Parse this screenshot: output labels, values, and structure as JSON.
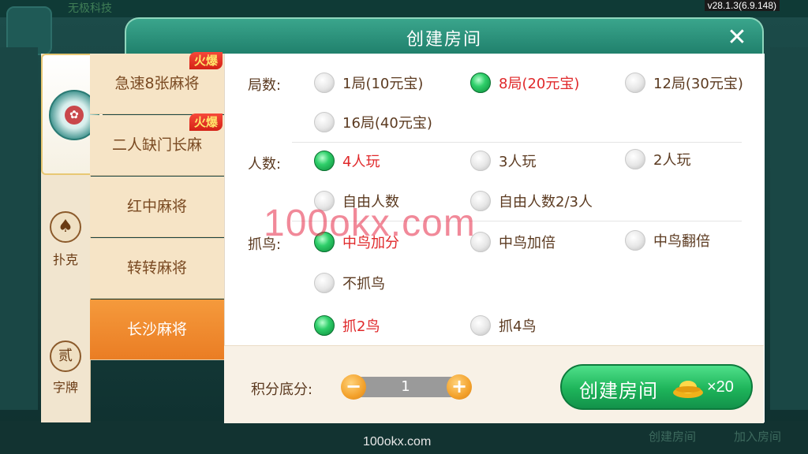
{
  "app": {
    "version": "v28.1.3(6.9.148)",
    "background_labels": [
      "无极科技"
    ],
    "bottom_watermark": "100okx.com",
    "overlay_watermark": "100okx.com",
    "bottom_bar": [
      "创建房间",
      "加入房间"
    ]
  },
  "dialog": {
    "title": "创建房间",
    "close_icon": "close-icon"
  },
  "categories": [
    {
      "label": "",
      "icon": "mahjong-emblem-icon",
      "active": true
    },
    {
      "label": "扑克",
      "icon": "spade-icon",
      "active": false
    },
    {
      "label": "字牌",
      "icon": "zipai-icon",
      "active": false
    }
  ],
  "games": [
    {
      "label": "急速8张麻将",
      "badge": "火爆",
      "active": false
    },
    {
      "label": "二人缺门长麻",
      "badge": "火爆",
      "active": false
    },
    {
      "label": "红中麻将",
      "badge": "",
      "active": false
    },
    {
      "label": "转转麻将",
      "badge": "",
      "active": false
    },
    {
      "label": "长沙麻将",
      "badge": "",
      "active": true
    }
  ],
  "options": {
    "rounds": {
      "label": "局数:",
      "items": [
        {
          "text": "1局(10元宝)",
          "selected": false
        },
        {
          "text": "8局(20元宝)",
          "selected": true
        },
        {
          "text": "12局(30元宝)",
          "selected": false
        },
        {
          "text": "16局(40元宝)",
          "selected": false
        }
      ]
    },
    "players": {
      "label": "人数:",
      "items": [
        {
          "text": "4人玩",
          "selected": true
        },
        {
          "text": "3人玩",
          "selected": false
        },
        {
          "text": "2人玩",
          "selected": false
        },
        {
          "text": "自由人数",
          "selected": false
        },
        {
          "text": "自由人数2/3人",
          "selected": false
        }
      ]
    },
    "birds": {
      "label": "抓鸟:",
      "items": [
        {
          "text": "中鸟加分",
          "selected": true
        },
        {
          "text": "中鸟加倍",
          "selected": false
        },
        {
          "text": "中鸟翻倍",
          "selected": false
        },
        {
          "text": "不抓鸟",
          "selected": false
        },
        {
          "text": "抓2鸟",
          "selected": true
        },
        {
          "text": "抓4鸟",
          "selected": false
        }
      ]
    }
  },
  "footer": {
    "score_label": "积分底分:",
    "score_value": "1",
    "minus": "−",
    "plus": "+",
    "create_label": "创建房间",
    "cost": "×20",
    "cost_icon": "gold-ingot-icon"
  },
  "colors": {
    "accent_green": "#1eb45a",
    "selected_text": "#e0282a",
    "active_tab": "#ea7d24",
    "header": "#1f7f6b"
  }
}
